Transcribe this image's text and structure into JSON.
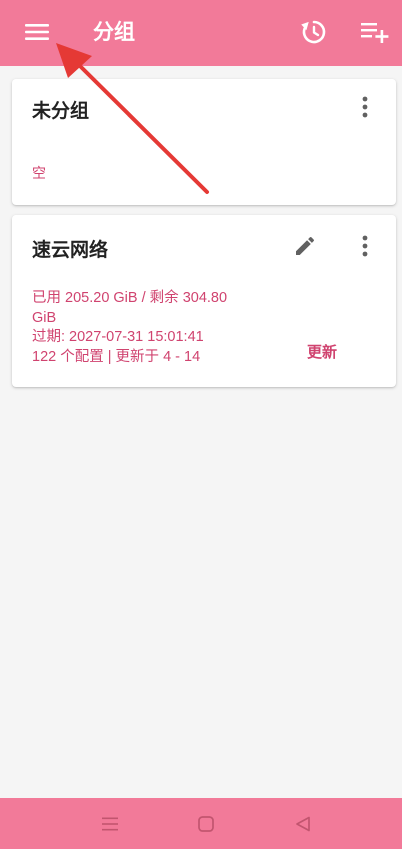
{
  "app_bar": {
    "title": "分组",
    "background": "#f27a99",
    "icons": [
      "menu-icon",
      "refresh-icon",
      "playlist-add-icon"
    ]
  },
  "groups": [
    {
      "name": "未分组",
      "empty_label": "空"
    },
    {
      "name": "速云网络",
      "usage_line_1": "已用 205.20 GiB / 剩余 304.80",
      "usage_line_2": "GiB",
      "expiry": "过期: 2027-07-31 15:01:41",
      "summary": "122 个配置 | 更新于 4 - 14",
      "update_label": "更新"
    }
  ],
  "accent_text_color": "#d0436f",
  "annotation": {
    "type": "arrow",
    "color": "#e53935",
    "points_to": "menu-button"
  },
  "nav_bar": {
    "background": "#f27a99",
    "icons": [
      "recents-icon",
      "home-icon",
      "back-icon"
    ]
  }
}
